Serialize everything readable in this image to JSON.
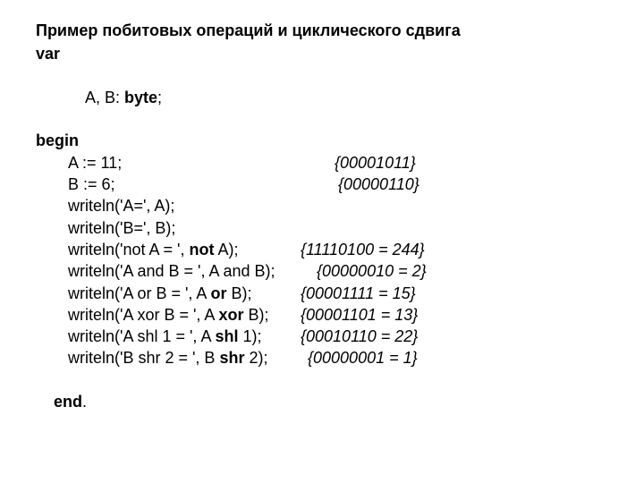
{
  "title": "Пример побитовых операций и циклического сдвига",
  "kw": {
    "var": "var",
    "begin": "begin",
    "end": "end",
    "byte": "byte",
    "not": "not",
    "or": "or",
    "xor": "xor",
    "shl": "shl",
    "shr": "shr"
  },
  "decl": {
    "prefix": "A, B: ",
    "suffix": ";"
  },
  "assignA": {
    "code": "A := 11;",
    "comment": "{00001011}"
  },
  "assignB": {
    "code": "B := 6;",
    "comment": "{00000110}"
  },
  "wA": "writeln('A=', A);",
  "wB": "writeln('B=', B);",
  "wNot": {
    "pre": "writeln('not A = ', ",
    "post": " A);",
    "comment": "{11110100 = 244}"
  },
  "wAnd": {
    "code": "writeln('A and B = ', A and B);",
    "comment": "{00000010 = 2}"
  },
  "wOr": {
    "pre": "writeln('A or B = ', A ",
    "post": " B);",
    "comment": "{00001111 = 15}"
  },
  "wXor": {
    "pre": "writeln('A xor B = ', A ",
    "post": " B);",
    "comment": "{00001101 = 13}"
  },
  "wShl": {
    "pre": "writeln('A shl 1 = ', A ",
    "mid": " 1);",
    "comment": "{00010110 = 22}"
  },
  "wShr": {
    "pre": "writeln('B shr 2 = ', B ",
    "mid": " 2);",
    "comment": "{00000001 = 1}"
  },
  "dot": "."
}
